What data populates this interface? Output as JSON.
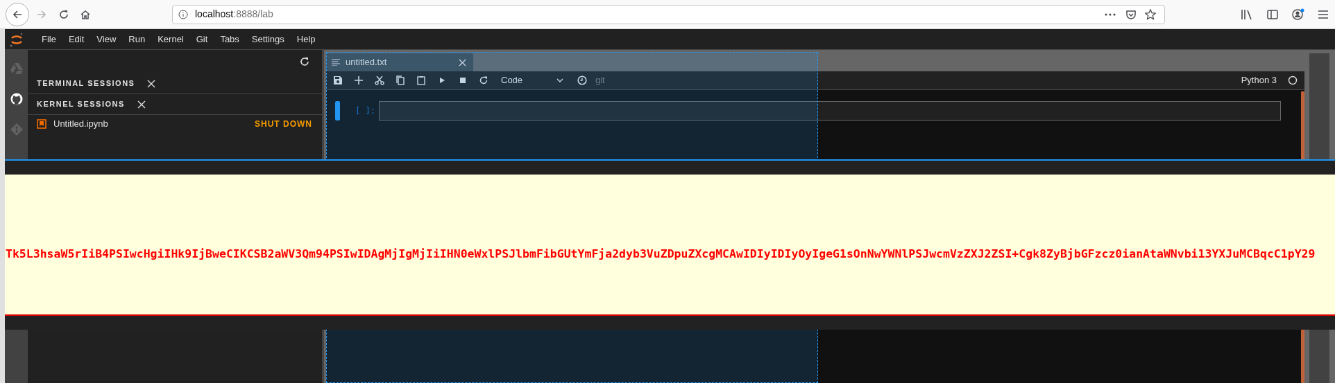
{
  "browser": {
    "url_host": "localhost",
    "url_path": ":8888/lab"
  },
  "menu": [
    "File",
    "Edit",
    "View",
    "Run",
    "Kernel",
    "Git",
    "Tabs",
    "Settings",
    "Help"
  ],
  "activity_bar": [
    {
      "kind": "drive",
      "selected": false
    },
    {
      "kind": "github",
      "selected": true
    },
    {
      "kind": "git",
      "selected": false
    }
  ],
  "sidebar": {
    "sections": [
      {
        "title": "TERMINAL SESSIONS"
      },
      {
        "title": "KERNEL SESSIONS",
        "items": [
          {
            "name": "Untitled.ipynb",
            "action": "SHUT DOWN"
          }
        ]
      }
    ]
  },
  "notebook": {
    "tab": {
      "title": "untitled.txt"
    },
    "cell_type": "Code",
    "git_label": "git",
    "kernel": "Python 3",
    "prompt": "[ ]:"
  },
  "error_text": "Tk5L3hsaW5rIiB4PSIwcHgiIHk9IjBweCIKCSB2aWV3Qm94PSIwIDAgMjIgMjIiIHN0eWxlPSJlbmFibGUtYmFja2dyb3VuZDpuZXcgMCAwIDIyIDIyOyIgeG1sOnNwYWNlPSJwcmVzZXJ2ZSI+Cgk8ZyBjbGFzcz0ianAtaWNvbi13YXJuMCBqcC1pY29"
}
